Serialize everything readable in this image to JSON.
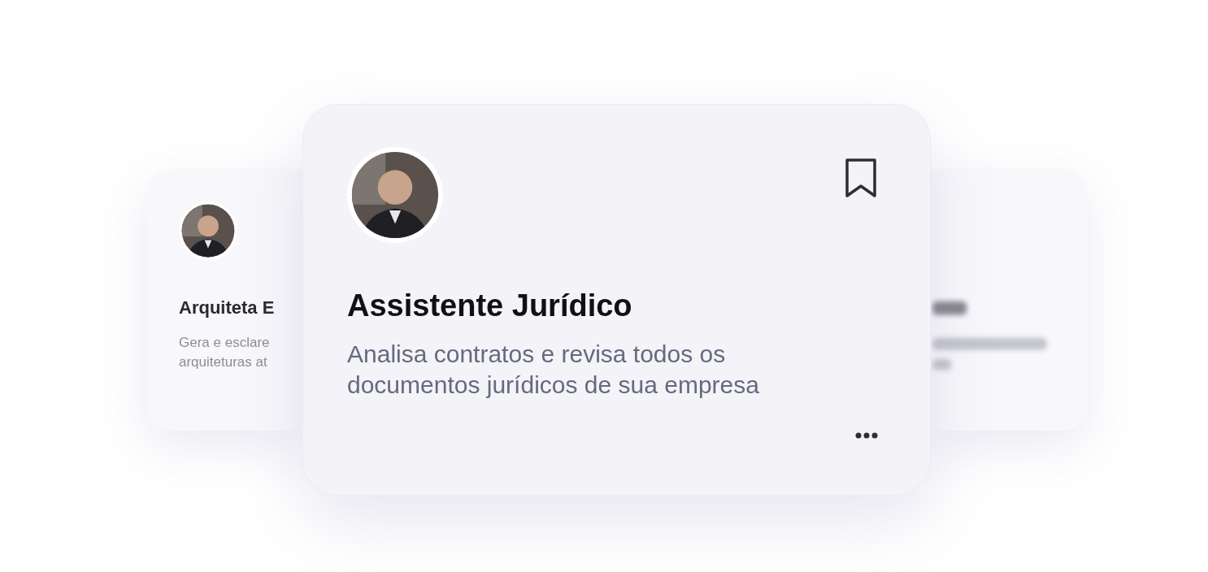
{
  "cards": [
    {
      "kind": "side",
      "title": "Arquiteta E",
      "description": [
        "Gera e esclare",
        "arquiteturas at"
      ]
    },
    {
      "kind": "blurred"
    },
    {
      "kind": "main",
      "title": "Assistente Jurídico",
      "description": [
        "Analisa contratos e revisa todos os",
        "documentos jurídicos de sua empresa"
      ]
    }
  ]
}
